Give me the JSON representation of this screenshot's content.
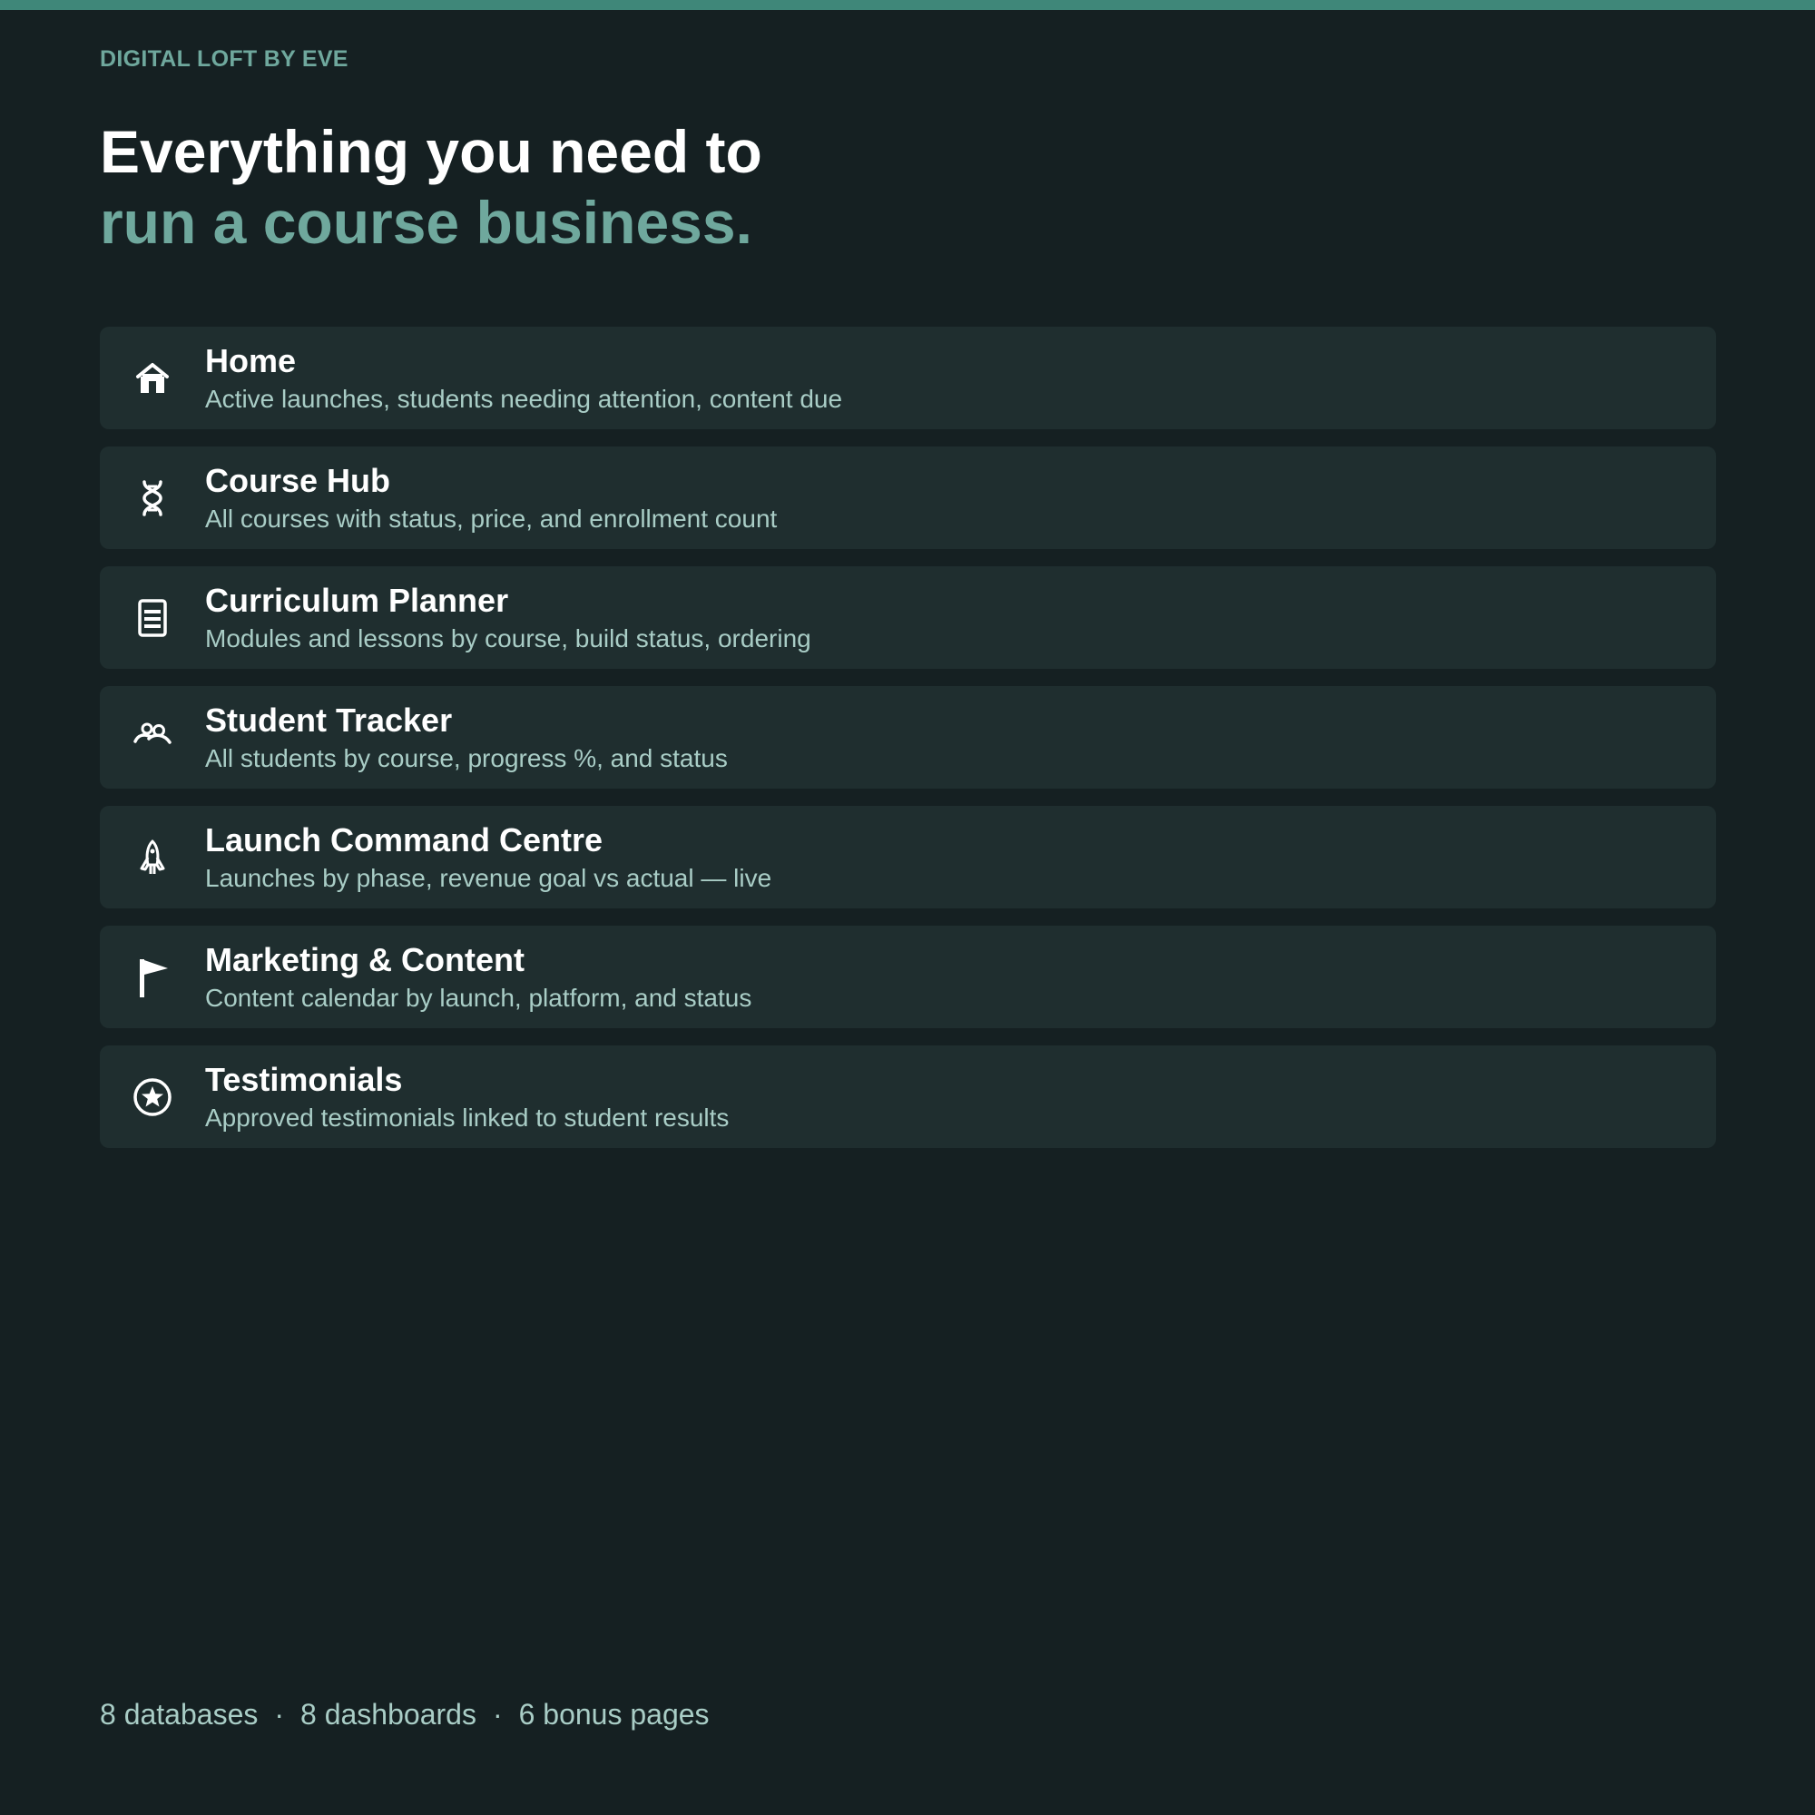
{
  "brand": "DIGITAL LOFT BY EVE",
  "headline": {
    "line1": "Everything you need to",
    "line2": "run a course business."
  },
  "features": [
    {
      "title": "Home",
      "desc": "Active launches, students needing attention, content due",
      "icon": "home-icon"
    },
    {
      "title": "Course Hub",
      "desc": "All courses with status, price, and enrollment count",
      "icon": "dna-icon"
    },
    {
      "title": "Curriculum Planner",
      "desc": "Modules and lessons by course, build status, ordering",
      "icon": "document-list-icon"
    },
    {
      "title": "Student Tracker",
      "desc": "All students by course, progress %, and status",
      "icon": "people-icon"
    },
    {
      "title": "Launch Command Centre",
      "desc": "Launches by phase, revenue goal vs actual — live",
      "icon": "rocket-icon"
    },
    {
      "title": "Marketing & Content",
      "desc": "Content calendar by launch, platform, and status",
      "icon": "flag-icon"
    },
    {
      "title": "Testimonials",
      "desc": "Approved testimonials linked to student results",
      "icon": "star-circle-icon"
    }
  ],
  "footer": {
    "databases": "8 databases",
    "dashboards": "8 dashboards",
    "bonus": "6 bonus pages",
    "separator": "·"
  },
  "colors": {
    "background": "#152022",
    "accent_bar": "#3f8779",
    "accent_text": "#6fa89d",
    "card": "#1f2e2f",
    "muted_text": "#a9cdc6"
  }
}
